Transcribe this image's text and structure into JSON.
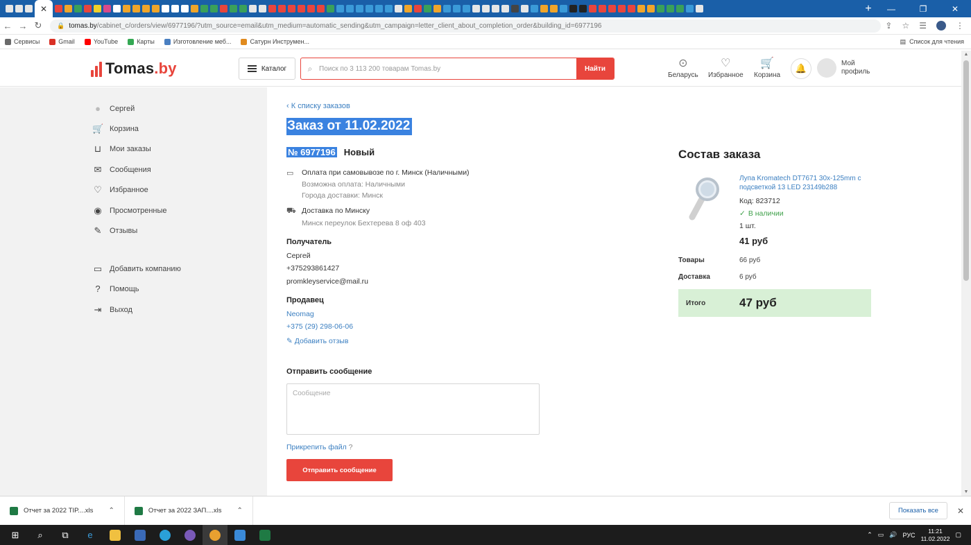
{
  "browser": {
    "active_tab_close": "✕",
    "new_tab": "+",
    "window_controls": {
      "minimize": "—",
      "maximize": "❐",
      "close": "✕"
    },
    "url": {
      "host": "tomas.by",
      "path": "/cabinet_c/orders/view/6977196/?utm_source=email&utm_medium=automatic_sending&utm_campaign=letter_client_about_completion_order&building_id=6977196"
    },
    "bookmarks": [
      {
        "label": "Сервисы",
        "color": "#6a6a6a"
      },
      {
        "label": "Gmail",
        "color": "#d93025"
      },
      {
        "label": "YouTube",
        "color": "#ff0000"
      },
      {
        "label": "Карты",
        "color": "#34a853"
      },
      {
        "label": "Изготовление меб...",
        "color": "#4a7fc1"
      },
      {
        "label": "Сатурн Инструмен...",
        "color": "#e08a1e"
      }
    ],
    "reading_list": "Список для чтения"
  },
  "header": {
    "logo_name": "Tomas",
    "logo_tld": ".by",
    "catalog_label": "Каталог",
    "search_placeholder": "Поиск по 3 113 200 товарам Tomas.by",
    "search_button": "Найти",
    "region_label": "Беларусь",
    "favorites_label": "Избранное",
    "cart_label": "Корзина",
    "profile_label_1": "Мой",
    "profile_label_2": "профиль"
  },
  "sidebar": {
    "items": [
      {
        "label": "Сергей",
        "icon": "user-icon"
      },
      {
        "label": "Корзина",
        "icon": "cart-icon"
      },
      {
        "label": "Мои заказы",
        "icon": "basket-icon"
      },
      {
        "label": "Сообщения",
        "icon": "mail-icon"
      },
      {
        "label": "Избранное",
        "icon": "heart-icon"
      },
      {
        "label": "Просмотренные",
        "icon": "eye-icon"
      },
      {
        "label": "Отзывы",
        "icon": "edit-icon"
      },
      {
        "label": "Добавить компанию",
        "icon": "briefcase-icon"
      },
      {
        "label": "Помощь",
        "icon": "help-icon"
      },
      {
        "label": "Выход",
        "icon": "logout-icon"
      }
    ]
  },
  "order": {
    "back_link": "К списку заказов",
    "title": "Заказ от 11.02.2022",
    "number": "№ 6977196",
    "status": "Новый",
    "payment": "Оплата при самовывозе по г. Минск (Наличными)",
    "payment_possible": "Возможна оплата: Наличными",
    "delivery_cities": "Города доставки: Минск",
    "delivery": "Доставка по Минску",
    "delivery_address": "Минск переулок Бехтерева 8 оф 403",
    "recipient_label": "Получатель",
    "recipient_name": "Сергей",
    "recipient_phone": "+375293861427",
    "recipient_email": "promkleyservice@mail.ru",
    "seller_label": "Продавец",
    "seller_name": "Neomag",
    "seller_phone": "+375 (29) 298-06-06",
    "add_review": "Добавить отзыв",
    "send_message_label": "Отправить сообщение",
    "message_placeholder": "Сообщение",
    "attach_file": "Прикрепить файл",
    "send_button": "Отправить сообщение"
  },
  "composition": {
    "title": "Состав заказа",
    "product_name": "Лупа Kromatech DT7671 30x-125mm с подсветкой 13 LED 23149b288",
    "code": "Код: 823712",
    "in_stock": "В наличии",
    "quantity": "1 шт.",
    "price": "41 руб",
    "goods_label": "Товары",
    "goods_value": "66 руб",
    "delivery_label": "Доставка",
    "delivery_value": "6 руб",
    "total_label": "Итого",
    "total_value": "47 руб"
  },
  "downloads": {
    "items": [
      {
        "name": "Отчет за 2022 TIP....xls"
      },
      {
        "name": "Отчет за 2022 ЗАП....xls"
      }
    ],
    "show_all": "Показать все"
  },
  "taskbar": {
    "lang": "РУС",
    "time": "11:21",
    "date": "11.02.2022"
  },
  "colors": {
    "brand_red": "#e8453c",
    "link_blue": "#3b7fc1",
    "selection_blue": "#3a82e0",
    "total_bg": "#d8f0d6",
    "in_stock_green": "#3fa04a",
    "chrome_tabstrip": "#1a5fa8"
  }
}
